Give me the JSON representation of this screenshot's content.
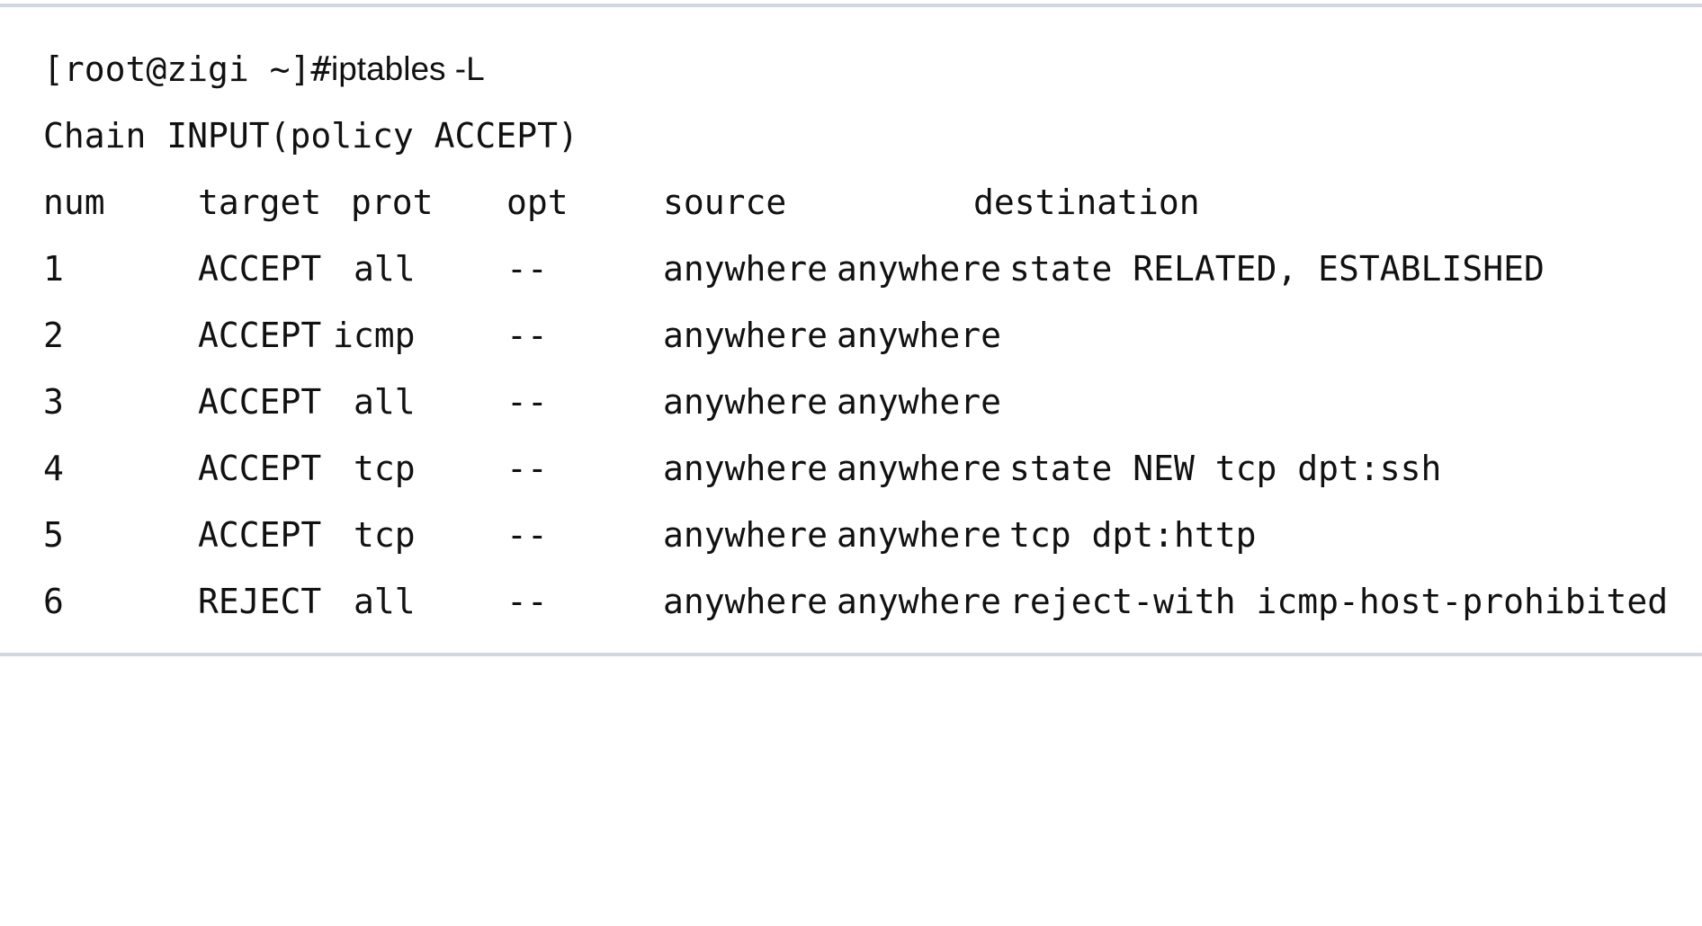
{
  "terminal": {
    "prompt": "[root@zigi ~]#",
    "command": "iptables -L",
    "chain_header": "Chain INPUT(policy ACCEPT)",
    "columns": {
      "num": "num",
      "target": "target",
      "prot": "prot",
      "opt": "opt",
      "source": "source",
      "destination": "destination"
    },
    "rows": [
      {
        "num": "1",
        "target": "ACCEPT",
        "prot": "all",
        "opt": "--",
        "source": "anywhere",
        "destination": "anywhere",
        "extra": "state RELATED, ESTABLISHED"
      },
      {
        "num": "2",
        "target": "ACCEPT",
        "prot": "icmp",
        "opt": "--",
        "source": "anywhere",
        "destination": "anywhere",
        "extra": ""
      },
      {
        "num": "3",
        "target": "ACCEPT",
        "prot": "all",
        "opt": "--",
        "source": "anywhere",
        "destination": "anywhere",
        "extra": ""
      },
      {
        "num": "4",
        "target": "ACCEPT",
        "prot": "tcp",
        "opt": "--",
        "source": "anywhere",
        "destination": "anywhere",
        "extra": "state NEW tcp dpt:ssh"
      },
      {
        "num": "5",
        "target": "ACCEPT",
        "prot": "tcp",
        "opt": "--",
        "source": "anywhere",
        "destination": "anywhere",
        "extra": "tcp dpt:http"
      },
      {
        "num": "6",
        "target": "REJECT",
        "prot": "all",
        "opt": "--",
        "source": "anywhere",
        "destination": "anywhere",
        "extra": "reject-with icmp-host-prohibited"
      }
    ]
  }
}
